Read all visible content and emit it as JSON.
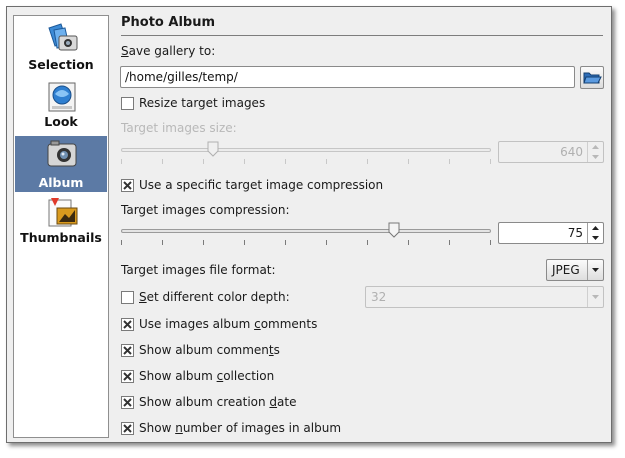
{
  "sidebar": {
    "items": [
      {
        "label": "Selection",
        "icon": "selection-icon",
        "active": false
      },
      {
        "label": "Look",
        "icon": "look-icon",
        "active": false
      },
      {
        "label": "Album",
        "icon": "album-icon",
        "active": true
      },
      {
        "label": "Thumbnails",
        "icon": "thumbnails-icon",
        "active": false
      }
    ],
    "active_color": "#5c7aa5"
  },
  "main": {
    "title": "Photo Album",
    "save_gallery": {
      "label_first": "S",
      "label_rest": "ave gallery to:",
      "value": "/home/gilles/temp/",
      "browse_icon": "folder-open-icon"
    },
    "resize": {
      "label": "Resize target images",
      "checked": false
    },
    "target_size": {
      "label": "Target images size:",
      "value": "640",
      "enabled": false,
      "slider_fraction": 0.19
    },
    "compression_toggle": {
      "label": "Use a specific target image compression",
      "checked": true
    },
    "compression": {
      "label": "Target images compression:",
      "value": "75",
      "enabled": true,
      "slider_fraction": 0.75
    },
    "file_format": {
      "label": "Target images file format:",
      "value": "JPEG"
    },
    "color_depth": {
      "label_first": "S",
      "label_rest": "et different color depth:",
      "checked": false,
      "value": "32",
      "enabled": false
    },
    "use_album_comments": {
      "label_pre": "Use images album ",
      "label_u": "c",
      "label_post": "omments",
      "checked": true
    },
    "show_album_comments": {
      "label_pre": "Show album commen",
      "label_u": "t",
      "label_post": "s",
      "checked": true
    },
    "show_album_collection": {
      "label_pre": "Show album ",
      "label_u": "c",
      "label_post": "ollection",
      "checked": true
    },
    "show_album_creation_date": {
      "label_pre": "Show album creation ",
      "label_u": "d",
      "label_post": "ate",
      "checked": true
    },
    "show_number_images": {
      "label_pre": "Show ",
      "label_u": "n",
      "label_post": "umber of images in album",
      "checked": true
    }
  }
}
